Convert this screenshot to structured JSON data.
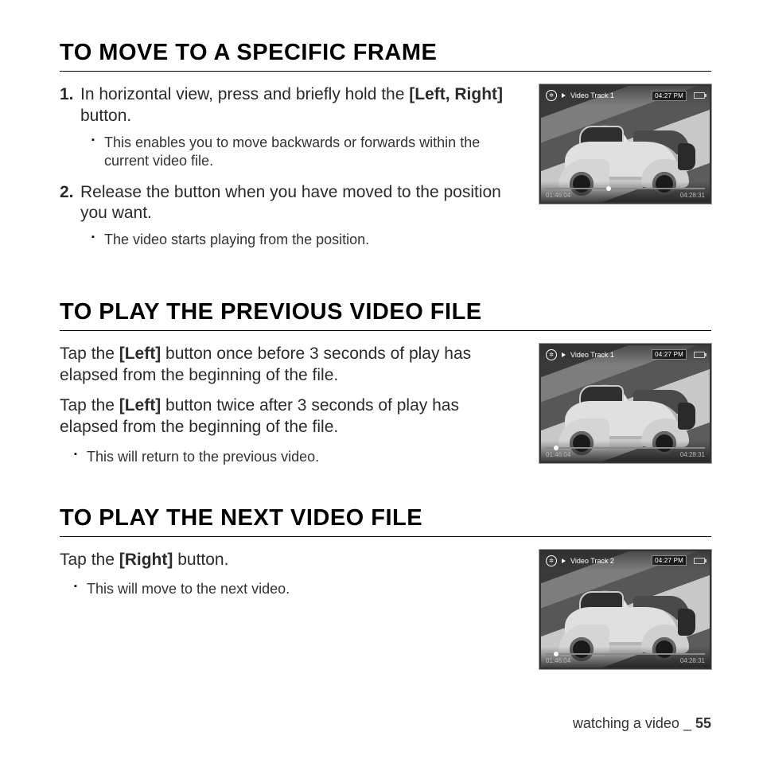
{
  "sections": [
    {
      "heading": "TO MOVE TO A SPECIFIC FRAME",
      "steps": [
        {
          "num": "1.",
          "pre": "In horizontal view, press and briefly hold the ",
          "bold": "[Left, Right]",
          "post": " button.",
          "sub": [
            "This enables you to move backwards or forwards within the current video file."
          ]
        },
        {
          "num": "2.",
          "pre": "Release the button when you have moved to the position you want.",
          "bold": "",
          "post": "",
          "sub": [
            "The video starts playing from the position."
          ]
        }
      ],
      "thumb": {
        "track": "Video Track 1",
        "clock": "04:27 PM",
        "elapsed": "01:46:04",
        "total": "04:28:31",
        "progress": 0.38
      }
    },
    {
      "heading": "TO PLAY THE PREVIOUS VIDEO FILE",
      "paras": [
        {
          "pre": "Tap the ",
          "bold": "[Left]",
          "post": " button once before 3 seconds of play has elapsed from the beginning of the file."
        },
        {
          "pre": "Tap the ",
          "bold": "[Left]",
          "post": " button twice after 3 seconds of play has elapsed from the beginning of the file."
        }
      ],
      "bullets": [
        "This will return to the previous video."
      ],
      "thumb": {
        "track": "Video Track 1",
        "clock": "04:27 PM",
        "elapsed": "01:46:04",
        "total": "04:28:31",
        "progress": 0.05
      }
    },
    {
      "heading": "TO PLAY THE NEXT VIDEO FILE",
      "paras": [
        {
          "pre": "Tap the ",
          "bold": "[Right]",
          "post": " button."
        }
      ],
      "bullets": [
        "This will move to the next video."
      ],
      "thumb": {
        "track": "Video Track 2",
        "clock": "04:27 PM",
        "elapsed": "01:46:04",
        "total": "04:28:31",
        "progress": 0.05
      }
    }
  ],
  "footer": {
    "label": "watching a video _ ",
    "page": "55"
  }
}
